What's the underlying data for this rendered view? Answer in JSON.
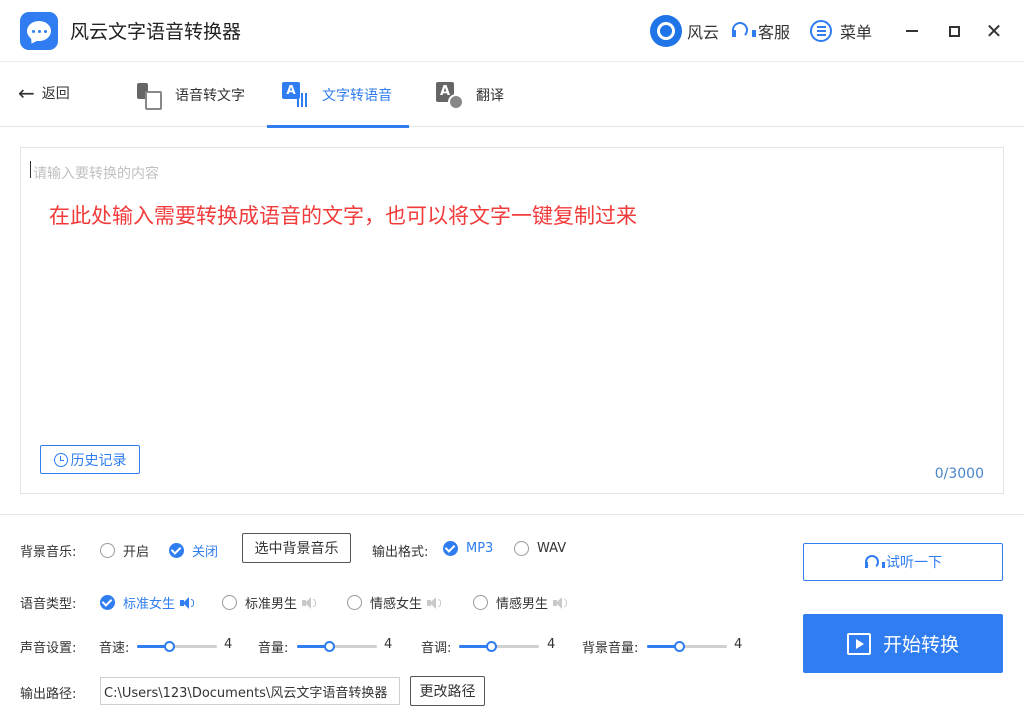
{
  "window": {
    "title": "风云文字语音转换器",
    "brand_label": "风云",
    "service_label": "客服",
    "menu_label": "菜单"
  },
  "nav": {
    "back_label": "返回",
    "tabs": [
      {
        "label": "语音转文字",
        "icon": "mic-doc-icon",
        "active": false
      },
      {
        "label": "文字转语音",
        "icon": "text-voice-icon",
        "active": true
      },
      {
        "label": "翻译",
        "icon": "translate-icon",
        "active": false
      }
    ]
  },
  "editor": {
    "placeholder": "请输入要转换的内容",
    "overlay_hint": "在此处输入需要转换成语音的文字，也可以将文字一键复制过来",
    "history_label": "历史记录",
    "char_count": "0/3000"
  },
  "settings": {
    "bg_music": {
      "label": "背景音乐:",
      "options": [
        {
          "label": "开启",
          "selected": false
        },
        {
          "label": "关闭",
          "selected": true
        }
      ],
      "select_button": "选中背景音乐"
    },
    "output_format": {
      "label": "输出格式:",
      "options": [
        {
          "label": "MP3",
          "selected": true
        },
        {
          "label": "WAV",
          "selected": false
        }
      ]
    },
    "voice_type": {
      "label": "语音类型:",
      "options": [
        {
          "label": "标准女生",
          "selected": true
        },
        {
          "label": "标准男生",
          "selected": false
        },
        {
          "label": "情感女生",
          "selected": false
        },
        {
          "label": "情感男生",
          "selected": false
        }
      ]
    },
    "sound": {
      "label": "声音设置:",
      "sliders": [
        {
          "label": "音速:",
          "value": "4",
          "level": 0.4
        },
        {
          "label": "音量:",
          "value": "4",
          "level": 0.4
        },
        {
          "label": "音调:",
          "value": "4",
          "level": 0.4
        },
        {
          "label": "背景音量:",
          "value": "4",
          "level": 0.4
        }
      ]
    },
    "output_path": {
      "label": "输出路径:",
      "value": "C:\\Users\\123\\Documents\\风云文字语音转换器",
      "change_button": "更改路径"
    }
  },
  "actions": {
    "listen_label": "试听一下",
    "start_label": "开始转换"
  },
  "colors": {
    "accent": "#2f7df0",
    "hint_red": "#f23b3b"
  }
}
